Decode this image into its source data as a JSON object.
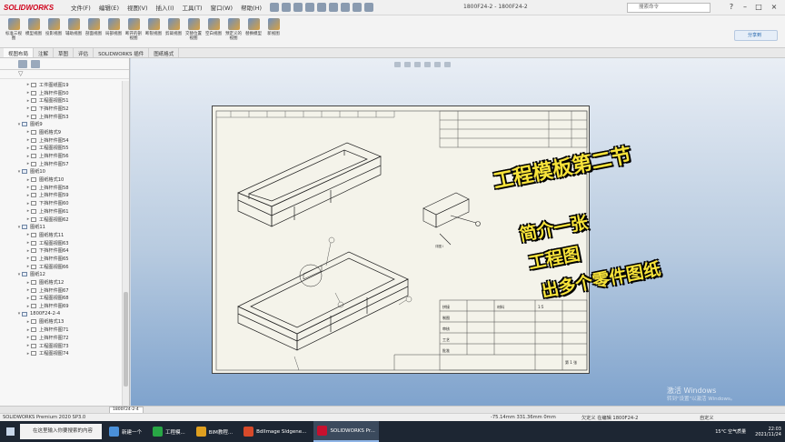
{
  "app": {
    "logo": "SOLIDWORKS",
    "doc_title": "1800F24-2 - 1800F24-2",
    "search_placeholder": "搜索命令"
  },
  "menu": [
    "文件(F)",
    "编辑(E)",
    "视图(V)",
    "插入(I)",
    "工具(T)",
    "窗口(W)",
    "帮助(H)"
  ],
  "ribbon_buttons": [
    "标准三视图",
    "模型视图",
    "投影视图",
    "辅助视图",
    "剖面视图",
    "局部视图",
    "断开的剖视图",
    "断裂视图",
    "剪裁视图",
    "交替位置视图",
    "空白视图",
    "预定义的视图",
    "替换模型",
    "新视图"
  ],
  "share_label": "分享到",
  "command_tabs": [
    "视图布局",
    "注解",
    "草图",
    "评估",
    "SOLIDWORKS 插件",
    "图纸格式"
  ],
  "feature_tree": [
    {
      "type": "part",
      "label": "工件图纸图19"
    },
    {
      "type": "part",
      "label": "上挡杆件图50"
    },
    {
      "type": "part",
      "label": "工程图视图51"
    },
    {
      "type": "part",
      "label": "下挡杆件图52"
    },
    {
      "type": "part",
      "label": "上挡杆件图53"
    },
    {
      "type": "view",
      "label": "图纸9"
    },
    {
      "type": "part",
      "label": "图纸格式9"
    },
    {
      "type": "part",
      "label": "上挡杆件图54"
    },
    {
      "type": "part",
      "label": "工程图视图55"
    },
    {
      "type": "part",
      "label": "上挡杆件图56"
    },
    {
      "type": "part",
      "label": "上挡杆件图57"
    },
    {
      "type": "view",
      "label": "图纸10"
    },
    {
      "type": "part",
      "label": "图纸格式10"
    },
    {
      "type": "part",
      "label": "上挡杆件图58"
    },
    {
      "type": "part",
      "label": "上挡杆件图59"
    },
    {
      "type": "part",
      "label": "下挡杆件图60"
    },
    {
      "type": "part",
      "label": "上挡杆件图61"
    },
    {
      "type": "part",
      "label": "工程图视图62"
    },
    {
      "type": "view",
      "label": "图纸11"
    },
    {
      "type": "part",
      "label": "图纸格式11"
    },
    {
      "type": "part",
      "label": "工程图视图63"
    },
    {
      "type": "part",
      "label": "下挡杆件图64"
    },
    {
      "type": "part",
      "label": "上挡杆件图65"
    },
    {
      "type": "part",
      "label": "工程图视图66"
    },
    {
      "type": "view",
      "label": "图纸12"
    },
    {
      "type": "part",
      "label": "图纸格式12"
    },
    {
      "type": "part",
      "label": "上挡杆件图67"
    },
    {
      "type": "part",
      "label": "工程图视图68"
    },
    {
      "type": "part",
      "label": "上挡杆件图69"
    },
    {
      "type": "view",
      "label": "1800F24-2-4"
    },
    {
      "type": "part",
      "label": "图纸格式13"
    },
    {
      "type": "part",
      "label": "上挡杆件图71"
    },
    {
      "type": "part",
      "label": "上挡杆件图72"
    },
    {
      "type": "part",
      "label": "工程图视图73"
    },
    {
      "type": "part",
      "label": "工程图视图74"
    }
  ],
  "sheet_tab": "1800F24-2-4",
  "title_block": {
    "rows": [
      "拼接",
      "制图",
      "审核",
      "工艺",
      "批准"
    ],
    "material": "材料",
    "scale": "1:5",
    "sheet": "第 1 张"
  },
  "overlay": {
    "title": "工程模板第二节",
    "lines": [
      "简介一张",
      "工程图",
      "出多个零件图纸"
    ]
  },
  "watermark": {
    "line1": "激活 Windows",
    "line2": "转到\"设置\"以激活 Windows。"
  },
  "status": {
    "app": "SOLIDWORKS Premium 2020 SP3.0",
    "coords": "-75.14mm     331.36mm     0mm",
    "sheet": "欠定义     在编辑 1800F24-2",
    "custom": "自定义"
  },
  "taskbar": {
    "search_text": "在这里输入你要搜索的内容",
    "apps": [
      {
        "label": "新建一个",
        "color": "#4a90d9"
      },
      {
        "label": "工程模...",
        "color": "#28a745"
      },
      {
        "label": "BIM教程...",
        "color": "#e0a020"
      },
      {
        "label": "BdlImage Sldgene...",
        "color": "#d84a2a"
      },
      {
        "label": "SOLIDWORKS Pr...",
        "color": "#c8102e"
      }
    ],
    "weather": "15°C  空气质量",
    "time": "22:03",
    "date": "2021/11/24"
  }
}
